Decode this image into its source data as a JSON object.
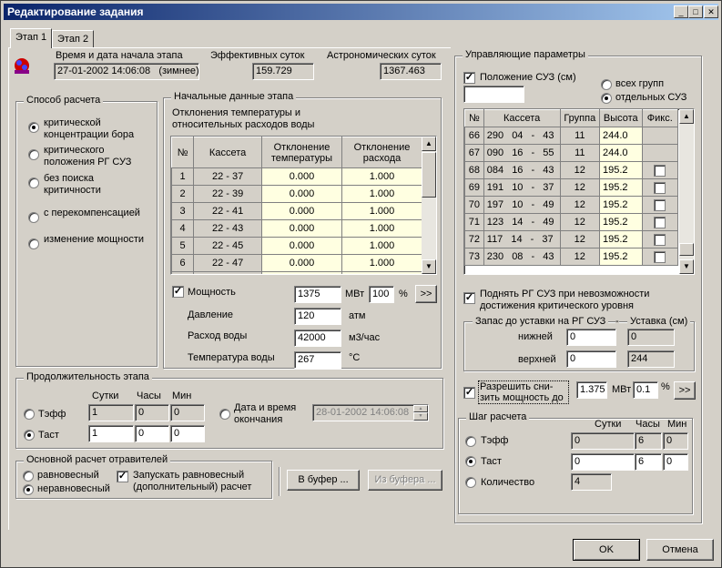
{
  "title": "Редактирование задания",
  "tabs": [
    "Этап 1",
    "Этап 2"
  ],
  "header": {
    "time_label": "Время и дата начала этапа",
    "time_value": "27-01-2002 14:06:08",
    "time_mode": "(зимнее)",
    "eff_label": "Эффективных суток",
    "eff_value": "159.729",
    "astro_label": "Астрономических суток",
    "astro_value": "1367.463"
  },
  "method": {
    "title": "Способ расчета",
    "options": [
      "критической концентрации бора",
      "критического положения РГ СУЗ",
      "без поиска критичности",
      "с перекомпенсацией",
      "изменение мощности"
    ],
    "selected": 0
  },
  "initial": {
    "title": "Начальные данные этапа",
    "subtitle1": "Отклонения температуры и",
    "subtitle2": "относительных расходов воды",
    "cols": [
      "№",
      "Кассета",
      "Отклонение температуры",
      "Отклонение расхода"
    ],
    "rows": [
      [
        "1",
        "22 - 37",
        "0.000",
        "1.000"
      ],
      [
        "2",
        "22 - 39",
        "0.000",
        "1.000"
      ],
      [
        "3",
        "22 - 41",
        "0.000",
        "1.000"
      ],
      [
        "4",
        "22 - 43",
        "0.000",
        "1.000"
      ],
      [
        "5",
        "22 - 45",
        "0.000",
        "1.000"
      ],
      [
        "6",
        "22 - 47",
        "0.000",
        "1.000"
      ]
    ],
    "power_label": "Мощность",
    "power_value": "1375",
    "power_unit": "МВт",
    "power_pct": "100",
    "pct": "%",
    "pressure_label": "Давление",
    "pressure_value": "120",
    "pressure_unit": "атм",
    "flow_label": "Расход воды",
    "flow_value": "42000",
    "flow_unit": "м3/час",
    "temp_label": "Температура воды",
    "temp_value": "267",
    "temp_unit": "°С",
    "more": ">>"
  },
  "duration": {
    "title": "Продолжительность этапа",
    "cols": [
      "Сутки",
      "Часы",
      "Мин"
    ],
    "teff_label": "Тэфф",
    "teff": [
      "1",
      "0",
      "0"
    ],
    "tast_label": "Таст",
    "tast": [
      "1",
      "0",
      "0"
    ],
    "end_label1": "Дата и время",
    "end_label2": "окончания",
    "end_value": "28-01-2002 14:06:08"
  },
  "poisons": {
    "title": "Основной расчет отравителей",
    "opt1": "равновесный",
    "opt2": "неравновесный",
    "extra1": "Запускать равновесный",
    "extra2": "(дополнительный) расчет"
  },
  "buffer": {
    "to": "В буфер ...",
    "from": "Из буфера ..."
  },
  "control": {
    "title": "Управляющие параметры",
    "suz_label": "Положение СУЗ (см)",
    "all_groups": "всех групп",
    "sep_groups": "отдельных СУЗ",
    "cols": [
      "№",
      "Кассета",
      "Группа",
      "Высота",
      "Фикс."
    ],
    "rows": [
      [
        "66",
        "290",
        "04 - 43",
        "11",
        "244.0",
        ""
      ],
      [
        "67",
        "090",
        "16 - 55",
        "11",
        "244.0",
        ""
      ],
      [
        "68",
        "084",
        "16 - 43",
        "12",
        "195.2",
        "□"
      ],
      [
        "69",
        "191",
        "10 - 37",
        "12",
        "195.2",
        "□"
      ],
      [
        "70",
        "197",
        "10 - 49",
        "12",
        "195.2",
        "□"
      ],
      [
        "71",
        "123",
        "14 - 49",
        "12",
        "195.2",
        "□"
      ],
      [
        "72",
        "117",
        "14 - 37",
        "12",
        "195.2",
        "□"
      ],
      [
        "73",
        "230",
        "08 - 43",
        "12",
        "195.2",
        "□"
      ]
    ],
    "raise1": "Поднять РГ СУЗ при невозможности",
    "raise2": "достижения критического уровня",
    "margin_title": "Запас до уставки на РГ СУЗ",
    "setpoint_title": "Уставка (см)",
    "lower_label": "нижней",
    "lower_value": "0",
    "lower_set": "0",
    "upper_label": "верхней",
    "upper_value": "0",
    "upper_set": "244",
    "allow1": "Разрешить сни-",
    "allow2": "зить мощность до",
    "allow_value": "1.375",
    "allow_unit": "МВт",
    "allow_pct": "0.1",
    "pct": "%",
    "more": ">>"
  },
  "step": {
    "title": "Шаг расчета",
    "cols": [
      "Сутки",
      "Часы",
      "Мин"
    ],
    "teff_label": "Тэфф",
    "teff": [
      "0",
      "6",
      "0"
    ],
    "tast_label": "Таст",
    "tast": [
      "0",
      "6",
      "0"
    ],
    "count_label": "Количество",
    "count": "4"
  },
  "ok": "OK",
  "cancel": "Отмена"
}
